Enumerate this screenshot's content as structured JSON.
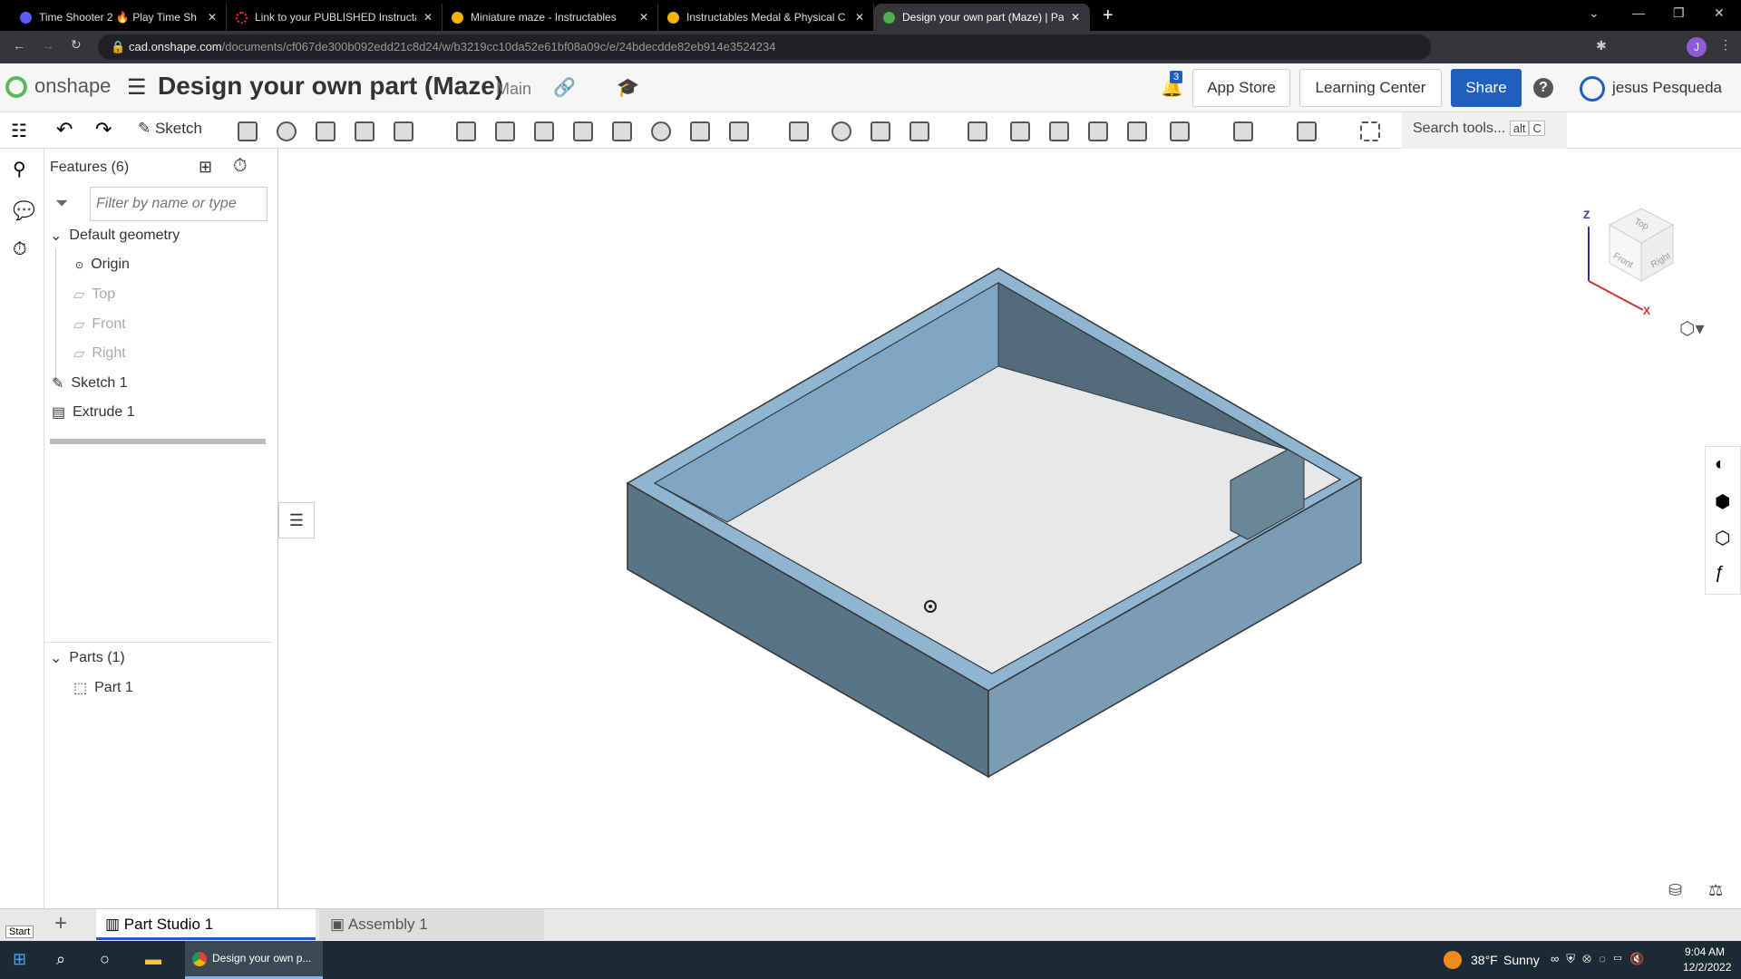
{
  "browser": {
    "tabs": [
      {
        "label": "Time Shooter 2 🔥 Play Time Sh",
        "color": "#5b5bff"
      },
      {
        "label": "Link to your PUBLISHED Instructa",
        "color": "#e33"
      },
      {
        "label": "Miniature maze - Instructables",
        "color": "#f5b400"
      },
      {
        "label": "Instructables Medal & Physical C",
        "color": "#f5b400"
      },
      {
        "label": "Design your own part (Maze) | Pa",
        "color": "#4caf50"
      }
    ],
    "new_tab": "+",
    "url_domain": "cad.onshape.com",
    "url_path": "/documents/cf067de300b092edd21c8d24/w/b3219cc10da52e61bf08a09c/e/24bdecdde82eb914e3524234",
    "profile": "J"
  },
  "header": {
    "logo": "onshape",
    "title": "Design your own part (Maze)",
    "branch": "Main",
    "notifications": "3",
    "app_store": "App Store",
    "learning_center": "Learning Center",
    "share": "Share",
    "help": "?",
    "user": "jesus Pesqueda"
  },
  "toolbar": {
    "sketch": "Sketch",
    "search": "Search tools...",
    "shortcut_alt": "alt",
    "shortcut_key": "C"
  },
  "features": {
    "title": "Features (6)",
    "filter_placeholder": "Filter by name or type",
    "default_geometry": "Default geometry",
    "items": [
      "Origin",
      "Top",
      "Front",
      "Right"
    ],
    "sketch": "Sketch 1",
    "extrude": "Extrude 1"
  },
  "parts": {
    "title": "Parts (1)",
    "items": [
      "Part 1"
    ]
  },
  "viewcube": {
    "top": "Top",
    "front": "Front",
    "right": "Right",
    "z": "Z",
    "x": "X"
  },
  "bottom_tabs": {
    "part_studio": "Part Studio 1",
    "assembly": "Assembly 1",
    "start": "Start"
  },
  "taskbar": {
    "app": "Design your own p...",
    "temp": "38°F",
    "weather": "Sunny",
    "time": "9:04 AM",
    "date": "12/2/2022"
  },
  "colors": {
    "accent": "#1f5fbf",
    "part": "#7ea3bd"
  }
}
